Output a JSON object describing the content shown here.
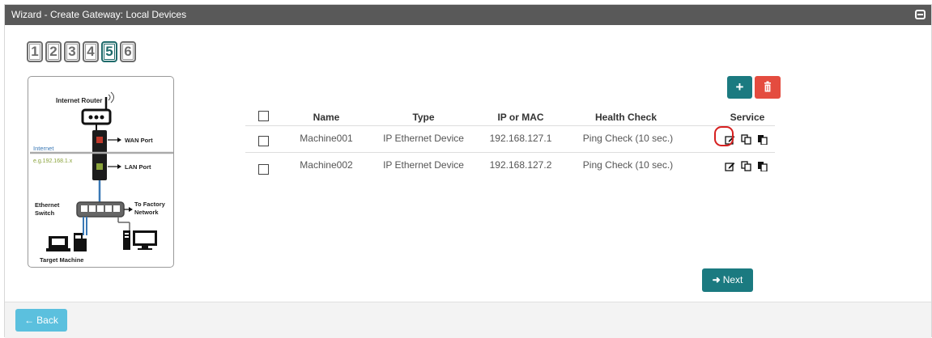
{
  "window": {
    "title": "Wizard - Create Gateway: Local Devices"
  },
  "steps": [
    "1",
    "2",
    "3",
    "4",
    "5",
    "6"
  ],
  "active_step": "5",
  "diagram": {
    "router_label": "Internet Router",
    "wan_label": "WAN Port",
    "internet_label": "Internet",
    "ip_example": "e.g.192.168.1.x",
    "lan_label": "LAN Port",
    "switch_label_1": "Ethernet",
    "switch_label_2": "Switch",
    "factory_label_1": "To Factory",
    "factory_label_2": "Network",
    "target_label": "Target Machine"
  },
  "toolbar": {
    "add_icon": "plus-icon",
    "delete_icon": "trash-icon"
  },
  "table": {
    "headers": {
      "name": "Name",
      "type": "Type",
      "ip": "IP or MAC",
      "health": "Health Check",
      "service": "Service"
    },
    "rows": [
      {
        "name": "Machine001",
        "type": "IP Ethernet Device",
        "ip": "192.168.127.1",
        "health": "Ping Check (10 sec.)"
      },
      {
        "name": "Machine002",
        "type": "IP Ethernet Device",
        "ip": "192.168.127.2",
        "health": "Ping Check (10 sec.)"
      }
    ]
  },
  "buttons": {
    "next": "Next",
    "back": "Back"
  },
  "colors": {
    "title_bar": "#595959",
    "teal": "#1b7a80",
    "red": "#e44c3f",
    "back": "#5bc0de",
    "highlight": "#d62020"
  }
}
